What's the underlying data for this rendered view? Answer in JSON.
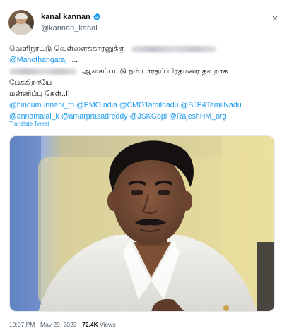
{
  "author": {
    "display_name": "kanal kannan",
    "handle": "@kannan_kanal",
    "verified": true
  },
  "close_icon": "×",
  "tweet": {
    "line1": "வெளிநாட்டு வெள்ளைக்காரனுக்கு",
    "mention_manothangaraj": "@Manothangaraj",
    "ellipsis": "...",
    "line3_text": "ஆசைப்பட்டு நம் பாரதப் பிரதமரை தவறாக",
    "line4": "பேசுகிறாயே",
    "line5": "மன்னிப்பு கேள்..!!",
    "mentions_row1": [
      "@hindumunnani_tn",
      "@PMOIndia",
      "@CMOTamilnadu",
      "@BJP4TamilNadu"
    ],
    "mentions_row2": [
      "@annamalai_k",
      "@amarprasadreddy",
      "@JSKGopi",
      "@RajeshHM_org"
    ]
  },
  "translate_label": "Translate Tweet",
  "media": {
    "description_icon": "photo-of-man"
  },
  "footer": {
    "time": "10:07 PM",
    "separator": "·",
    "date": "May 29, 2023",
    "views_count": "72.4K",
    "views_label": "Views"
  },
  "colors": {
    "accent": "#1d9bf0",
    "verified": "#1d9bf0",
    "muted": "#536471"
  }
}
